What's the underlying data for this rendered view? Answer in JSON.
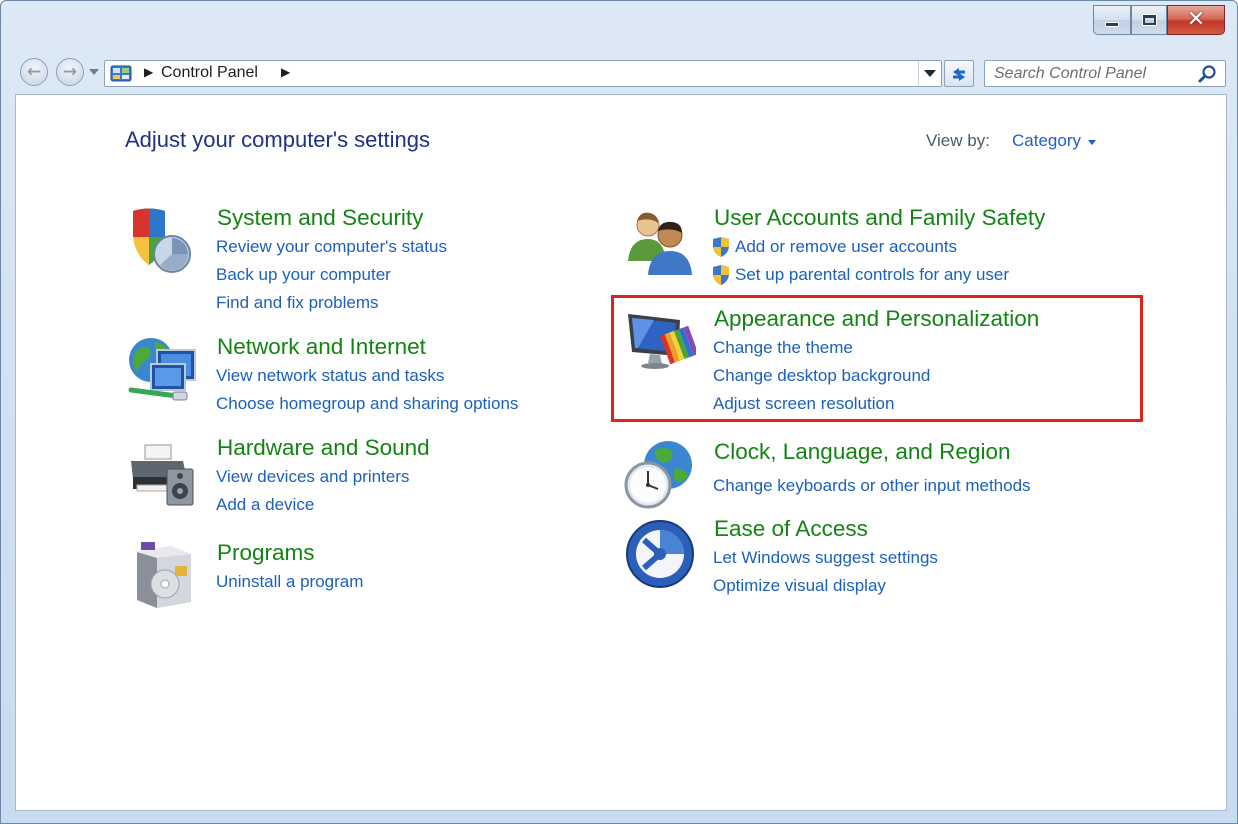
{
  "window": {
    "caption_buttons": {
      "minimize": "minimize-icon",
      "maximize": "maximize-icon",
      "close": "close-icon"
    }
  },
  "navigation": {
    "back_icon": "back-arrow-icon",
    "forward_icon": "forward-arrow-icon",
    "address": {
      "icon": "control-panel-icon",
      "breadcrumb": [
        "Control Panel"
      ]
    },
    "search_placeholder": "Search Control Panel"
  },
  "main": {
    "title": "Adjust your computer's settings",
    "view_by_label": "View by:",
    "view_by_value": "Category",
    "categories_left": [
      {
        "title": "System and Security",
        "icon": "shield-security-icon",
        "links": [
          "Review your computer's status",
          "Back up your computer",
          "Find and fix problems"
        ]
      },
      {
        "title": "Network and Internet",
        "icon": "network-globe-icon",
        "links": [
          "View network status and tasks",
          "Choose homegroup and sharing options"
        ]
      },
      {
        "title": "Hardware and Sound",
        "icon": "printer-speaker-icon",
        "links": [
          "View devices and printers",
          "Add a device"
        ]
      },
      {
        "title": "Programs",
        "icon": "programs-box-icon",
        "links": [
          "Uninstall a program"
        ]
      }
    ],
    "categories_right": [
      {
        "title": "User Accounts and Family Safety",
        "icon": "users-icon",
        "links": [
          "Add or remove user accounts",
          "Set up parental controls for any user"
        ],
        "link_icons": "uac-shield-icon"
      },
      {
        "title": "Appearance and Personalization",
        "icon": "monitor-palette-icon",
        "links": [
          "Change the theme",
          "Change desktop background",
          "Adjust screen resolution"
        ]
      },
      {
        "title": "Clock, Language, and Region",
        "icon": "clock-globe-icon",
        "links": [
          "Change keyboards or other input methods"
        ]
      },
      {
        "title": "Ease of Access",
        "icon": "ease-of-access-icon",
        "links": [
          "Let Windows suggest settings",
          "Optimize visual display"
        ]
      }
    ]
  },
  "annotation": {
    "highlight_color": "#e2211c"
  }
}
